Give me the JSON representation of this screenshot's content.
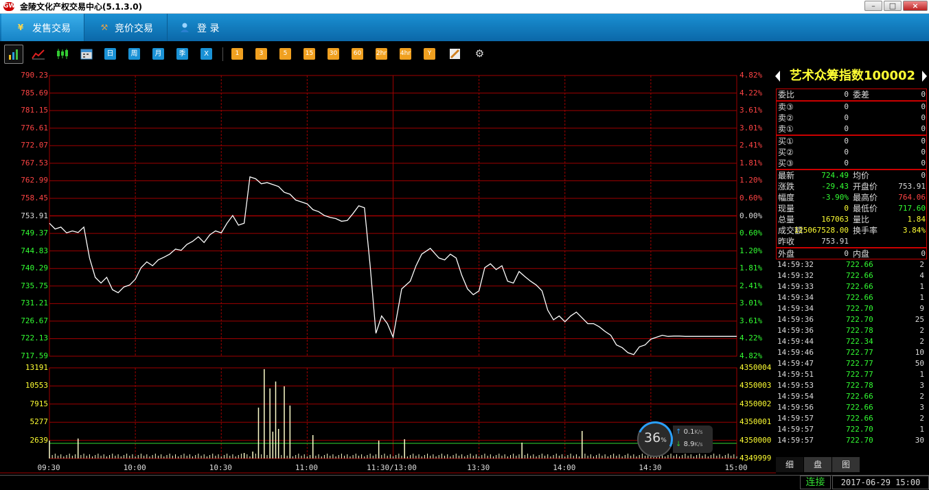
{
  "window": {
    "logo_text": "GW",
    "title": "金陵文化产权交易中心(5.1.3.0)"
  },
  "nav": {
    "tabs": [
      {
        "label": "发售交易",
        "icon": "yen-icon",
        "active": true
      },
      {
        "label": "竞价交易",
        "icon": "gavel-icon",
        "active": false
      },
      {
        "label": "登  录",
        "icon": "user-icon",
        "active": false
      }
    ]
  },
  "toolbar": {
    "periods": [
      "日",
      "周",
      "月",
      "季",
      "X"
    ],
    "minutes": [
      "1",
      "3",
      "5",
      "15",
      "30",
      "60",
      "2hr",
      "4hr",
      "Y"
    ]
  },
  "chart_data": [
    {
      "type": "line",
      "title": "",
      "x_ticks": [
        "09:30",
        "10:00",
        "10:30",
        "11:00",
        "11:30/13:00",
        "13:30",
        "14:00",
        "14:30",
        "15:00"
      ],
      "y_ticks_price": [
        "790.23",
        "785.69",
        "781.15",
        "776.61",
        "772.07",
        "767.53",
        "762.99",
        "758.45",
        "753.91",
        "749.37",
        "744.83",
        "740.29",
        "735.75",
        "731.21",
        "726.67",
        "722.13",
        "717.59"
      ],
      "y_ticks_pct": [
        "4.82%",
        "4.22%",
        "3.61%",
        "3.01%",
        "2.41%",
        "1.81%",
        "1.20%",
        "0.60%",
        "0.00%",
        "0.60%",
        "1.20%",
        "1.81%",
        "2.41%",
        "3.01%",
        "3.61%",
        "4.22%",
        "4.82%"
      ],
      "ylim": [
        717.59,
        790.23
      ],
      "base": 753.91,
      "series": [
        {
          "color": "#ffffff",
          "x": [
            0,
            2,
            4,
            6,
            8,
            10,
            12,
            14,
            16,
            18,
            20,
            22,
            24,
            26,
            28,
            30,
            32,
            34,
            36,
            38,
            40,
            42,
            44,
            46,
            48,
            50,
            52,
            54,
            56,
            58,
            60,
            62,
            64,
            66,
            68,
            70,
            72,
            74,
            76,
            78,
            80,
            82,
            84,
            86,
            88,
            90,
            92,
            94,
            96,
            98,
            100,
            102,
            104,
            106,
            108,
            110,
            112,
            114,
            116,
            118,
            120,
            123,
            126,
            128,
            130,
            133,
            136,
            138,
            140,
            142,
            144,
            146,
            148,
            150,
            152,
            154,
            156,
            158,
            160,
            162,
            164,
            166,
            168,
            170,
            172,
            174,
            176,
            178,
            180,
            182,
            184,
            186,
            188,
            190,
            192,
            194,
            196,
            198,
            200,
            202,
            204,
            206,
            208,
            210,
            212,
            214,
            216,
            218,
            220,
            222,
            224,
            226,
            228,
            230,
            232,
            234,
            236,
            238,
            240
          ],
          "y": [
            752.0,
            750.5,
            751.0,
            749.5,
            750.0,
            749.6,
            751.0,
            743.0,
            738.0,
            736.5,
            738.0,
            734.8,
            734.0,
            735.5,
            736.0,
            737.5,
            740.5,
            742.0,
            741.0,
            742.5,
            743.2,
            744.0,
            745.3,
            745.0,
            746.5,
            747.3,
            748.5,
            747.0,
            749.0,
            750.0,
            749.5,
            752.0,
            754.0,
            751.5,
            752.0,
            764.0,
            763.5,
            762.2,
            762.5,
            762.0,
            761.5,
            760.0,
            759.5,
            758.0,
            757.5,
            757.0,
            755.5,
            755.0,
            754.0,
            753.5,
            753.2,
            752.5,
            752.7,
            754.5,
            756.5,
            756.0,
            741.0,
            723.5,
            728.0,
            726.0,
            722.5,
            735.0,
            737.0,
            741.0,
            744.0,
            745.5,
            743.0,
            742.5,
            744.0,
            743.0,
            738.5,
            735.0,
            733.5,
            734.5,
            740.5,
            741.5,
            740.0,
            741.0,
            737.0,
            736.5,
            739.5,
            738.2,
            737.0,
            736.0,
            734.5,
            729.5,
            727.0,
            728.0,
            726.5,
            728.0,
            729.0,
            727.5,
            726.0,
            726.0,
            725.2,
            724.0,
            723.0,
            720.5,
            719.8,
            718.5,
            718.0,
            720.0,
            720.5,
            722.0,
            722.5,
            723.0,
            722.7,
            722.8,
            722.8,
            722.7,
            722.7,
            722.7,
            722.7,
            722.7,
            722.7,
            722.7,
            722.7,
            722.7,
            722.7
          ]
        }
      ]
    },
    {
      "type": "bar",
      "title": "",
      "y_ticks_left": [
        "13191",
        "10553",
        "7915",
        "5277",
        "2639"
      ],
      "y_ticks_right": [
        "4350004",
        "4350003",
        "4350002",
        "4350001",
        "4350000",
        "4349999"
      ],
      "ylim": [
        0,
        13191
      ],
      "right_line_value": 4350000,
      "series": [
        {
          "color": "#ffffcc",
          "x": [
            0,
            10,
            68,
            71,
            73,
            75,
            77,
            78,
            79,
            80,
            82,
            84,
            92,
            115,
            124,
            165,
            186
          ],
          "values": [
            2600,
            2900,
            800,
            1000,
            7400,
            13000,
            10200,
            3900,
            11200,
            4300,
            10500,
            7700,
            3400,
            2600,
            2800,
            2300,
            4000
          ]
        }
      ]
    }
  ],
  "quote": {
    "title": "艺术众筹指数100002",
    "wei": {
      "k1": "委比",
      "v1": "0",
      "k2": "委差",
      "v2": "0"
    },
    "asks": [
      {
        "label": "卖③",
        "price": "0",
        "vol": "0"
      },
      {
        "label": "卖②",
        "price": "0",
        "vol": "0"
      },
      {
        "label": "卖①",
        "price": "0",
        "vol": "0"
      }
    ],
    "bids": [
      {
        "label": "买①",
        "price": "0",
        "vol": "0"
      },
      {
        "label": "买②",
        "price": "0",
        "vol": "0"
      },
      {
        "label": "买③",
        "price": "0",
        "vol": "0"
      }
    ],
    "stats": [
      {
        "k1": "最新",
        "v1": "724.49",
        "c1": "#33ff33",
        "k2": "均价",
        "v2": "0",
        "c2": "#dddddd"
      },
      {
        "k1": "涨跌",
        "v1": "-29.43",
        "c1": "#33ff33",
        "k2": "开盘价",
        "v2": "753.91",
        "c2": "#dddddd"
      },
      {
        "k1": "幅度",
        "v1": "-3.90%",
        "c1": "#33ff33",
        "k2": "最高价",
        "v2": "764.06",
        "c2": "#ff4444"
      },
      {
        "k1": "现量",
        "v1": "0",
        "c1": "#ffff33",
        "k2": "最低价",
        "v2": "717.60",
        "c2": "#33ff33"
      },
      {
        "k1": "总量",
        "v1": "167063",
        "c1": "#ffff33",
        "k2": "量比",
        "v2": "1.84",
        "c2": "#ffff33"
      },
      {
        "k1": "成交额",
        "v1": "125067528.00",
        "c1": "#ffff33",
        "k2": "换手率",
        "v2": "3.84%",
        "c2": "#ffff33"
      },
      {
        "k1": "昨收",
        "v1": "753.91",
        "c1": "#dddddd",
        "k2": "",
        "v2": "",
        "c2": "#dddddd"
      }
    ],
    "outer": {
      "k1": "外盘",
      "v1": "0",
      "k2": "内盘",
      "v2": "0"
    },
    "ticks": [
      {
        "time": "14:59:32",
        "price": "722.66",
        "vol": "2"
      },
      {
        "time": "14:59:32",
        "price": "722.66",
        "vol": "4"
      },
      {
        "time": "14:59:33",
        "price": "722.66",
        "vol": "1"
      },
      {
        "time": "14:59:34",
        "price": "722.66",
        "vol": "1"
      },
      {
        "time": "14:59:34",
        "price": "722.70",
        "vol": "9"
      },
      {
        "time": "14:59:36",
        "price": "722.70",
        "vol": "25"
      },
      {
        "time": "14:59:36",
        "price": "722.78",
        "vol": "2"
      },
      {
        "time": "14:59:44",
        "price": "722.34",
        "vol": "2"
      },
      {
        "time": "14:59:46",
        "price": "722.77",
        "vol": "10"
      },
      {
        "time": "14:59:47",
        "price": "722.77",
        "vol": "50"
      },
      {
        "time": "14:59:51",
        "price": "722.77",
        "vol": "1"
      },
      {
        "time": "14:59:53",
        "price": "722.78",
        "vol": "3"
      },
      {
        "time": "14:59:54",
        "price": "722.66",
        "vol": "2"
      },
      {
        "time": "14:59:56",
        "price": "722.66",
        "vol": "3"
      },
      {
        "time": "14:59:57",
        "price": "722.66",
        "vol": "2"
      },
      {
        "time": "14:59:57",
        "price": "722.70",
        "vol": "1"
      },
      {
        "time": "14:59:57",
        "price": "722.70",
        "vol": "30"
      }
    ],
    "tabs": [
      "细",
      "盘",
      "图"
    ]
  },
  "speed": {
    "percent": "36",
    "percent_sign": "%",
    "up": "0.1",
    "down": "8.9",
    "unit": "K/s"
  },
  "status": {
    "connection": "连接",
    "datetime": "2017-06-29 15:00"
  },
  "colors": {
    "grid": "#a00000",
    "up_axis": "#ff4444",
    "down_axis": "#33ff33",
    "line": "#ffffff",
    "volume": "#ffffcc",
    "panel_title": "#ffff33"
  }
}
